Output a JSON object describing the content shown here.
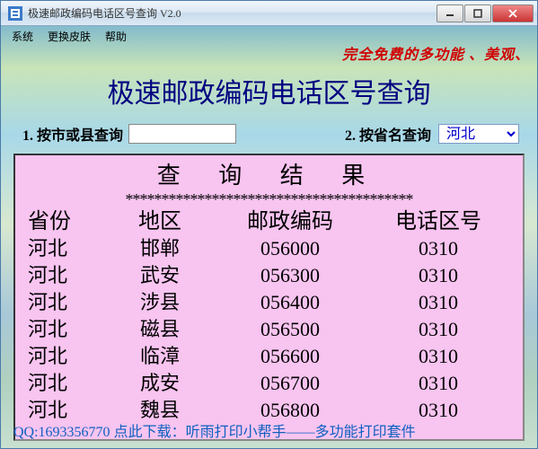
{
  "window": {
    "title": "极速邮政编码电话区号查询 V2.0",
    "icon": "app-icon"
  },
  "menu": {
    "system": "系统",
    "skin": "更换皮肤",
    "help": "帮助"
  },
  "banner": {
    "text": "完全免费的多功能 、美观、"
  },
  "app_title": "极速邮政编码电话区号查询",
  "search": {
    "label1": "1. 按市或县查询",
    "input_value": "",
    "label2": "2. 按省名查询",
    "province_selected": "河北"
  },
  "results": {
    "title": "查 询 结 果",
    "divider": "****************************************",
    "headers": {
      "province": "省份",
      "area": "地区",
      "zip": "邮政编码",
      "tel": "电话区号"
    },
    "rows": [
      {
        "province": "河北",
        "area": "邯郸",
        "zip": "056000",
        "tel": "0310"
      },
      {
        "province": "河北",
        "area": "武安",
        "zip": "056300",
        "tel": "0310"
      },
      {
        "province": "河北",
        "area": "涉县",
        "zip": "056400",
        "tel": "0310"
      },
      {
        "province": "河北",
        "area": "磁县",
        "zip": "056500",
        "tel": "0310"
      },
      {
        "province": "河北",
        "area": "临漳",
        "zip": "056600",
        "tel": "0310"
      },
      {
        "province": "河北",
        "area": "成安",
        "zip": "056700",
        "tel": "0310"
      },
      {
        "province": "河北",
        "area": "魏县",
        "zip": "056800",
        "tel": "0310"
      }
    ]
  },
  "footer": {
    "qq_label": "QQ:1693356770",
    "download_prefix": "  点此下载：",
    "download_link": "听雨打印小帮手——多功能打印套件"
  }
}
